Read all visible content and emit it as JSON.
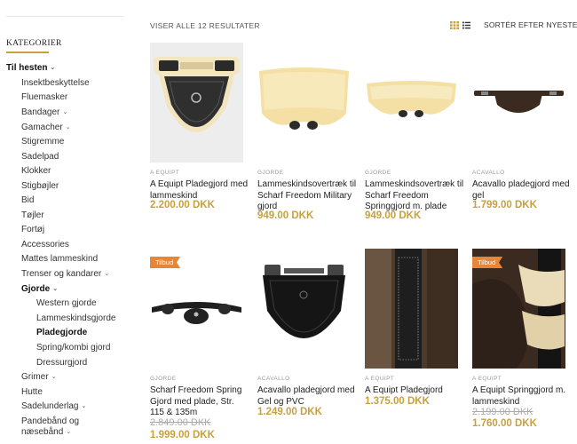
{
  "sidebar": {
    "heading": "KATEGORIER",
    "items": [
      {
        "label": "Til hesten",
        "chev": "⌄"
      },
      {
        "label": "Insektbeskyttelse"
      },
      {
        "label": "Fluemasker"
      },
      {
        "label": "Bandager",
        "chev": "⌄"
      },
      {
        "label": "Gamacher",
        "chev": "⌄"
      },
      {
        "label": "Stigremme"
      },
      {
        "label": "Sadelpad"
      },
      {
        "label": "Klokker"
      },
      {
        "label": "Stigbøjler"
      },
      {
        "label": "Bid"
      },
      {
        "label": "Tøjler"
      },
      {
        "label": "Fortøj"
      },
      {
        "label": "Accessories"
      },
      {
        "label": "Mattes lammeskind"
      },
      {
        "label": "Trenser og kandarer",
        "chev": "⌄"
      },
      {
        "label": "Gjorde",
        "chev": "⌄"
      },
      {
        "label": "Western gjorde"
      },
      {
        "label": "Lammeskindsgjorde"
      },
      {
        "label": "Pladegjorde"
      },
      {
        "label": "Spring/kombi gjord"
      },
      {
        "label": "Dressurgjord"
      },
      {
        "label": "Grimer",
        "chev": "⌄"
      },
      {
        "label": "Hutte"
      },
      {
        "label": "Sadelunderlag",
        "chev": "⌄"
      },
      {
        "label": "Pandebånd og"
      },
      {
        "label": "næsebånd",
        "chev": "⌄"
      }
    ]
  },
  "toolbar": {
    "results": "VISER ALLE 12 RESULTATER",
    "sort": "SORTÉR EFTER NYESTE",
    "sort_chev": "⌄"
  },
  "products": [
    {
      "brand": "A EQUIPT",
      "name": "A Equipt Pladegjord med lammeskind",
      "price": "2.200.00 DKK"
    },
    {
      "brand": "GJORDE",
      "name": "Lammeskindsovertræk til Scharf Freedom Military gjord",
      "price": "949.00 DKK"
    },
    {
      "brand": "GJORDE",
      "name": "Lammeskindsovertræk til Scharf Freedom Springgjord m. plade",
      "price": "949.00 DKK"
    },
    {
      "brand": "ACAVALLO",
      "name": "Acavallo pladegjord med gel",
      "price": "1.799.00 DKK"
    },
    {
      "brand": "GJORDE",
      "badge": "Tilbud",
      "name": "Scharf Freedom Spring Gjord med plade, Str. 115 & 135m",
      "old_price": "2.849.00 DKK",
      "price": "1.999.00 DKK"
    },
    {
      "brand": "ACAVALLO",
      "name": "Acavallo pladegjord med Gel og PVC",
      "price": "1.249.00 DKK"
    },
    {
      "brand": "A EQUIPT",
      "name": "A Equipt Pladegjord",
      "price": "1.375.00 DKK"
    },
    {
      "brand": "A EQUIPT",
      "badge": "Tilbud",
      "name": "A Equipt Springgjord m. lammeskind",
      "old_price": "2.199.00 DKK",
      "price": "1.760.00 DKK"
    }
  ],
  "colors": {
    "accent": "#c7a13f",
    "badge": "#e4873b"
  }
}
